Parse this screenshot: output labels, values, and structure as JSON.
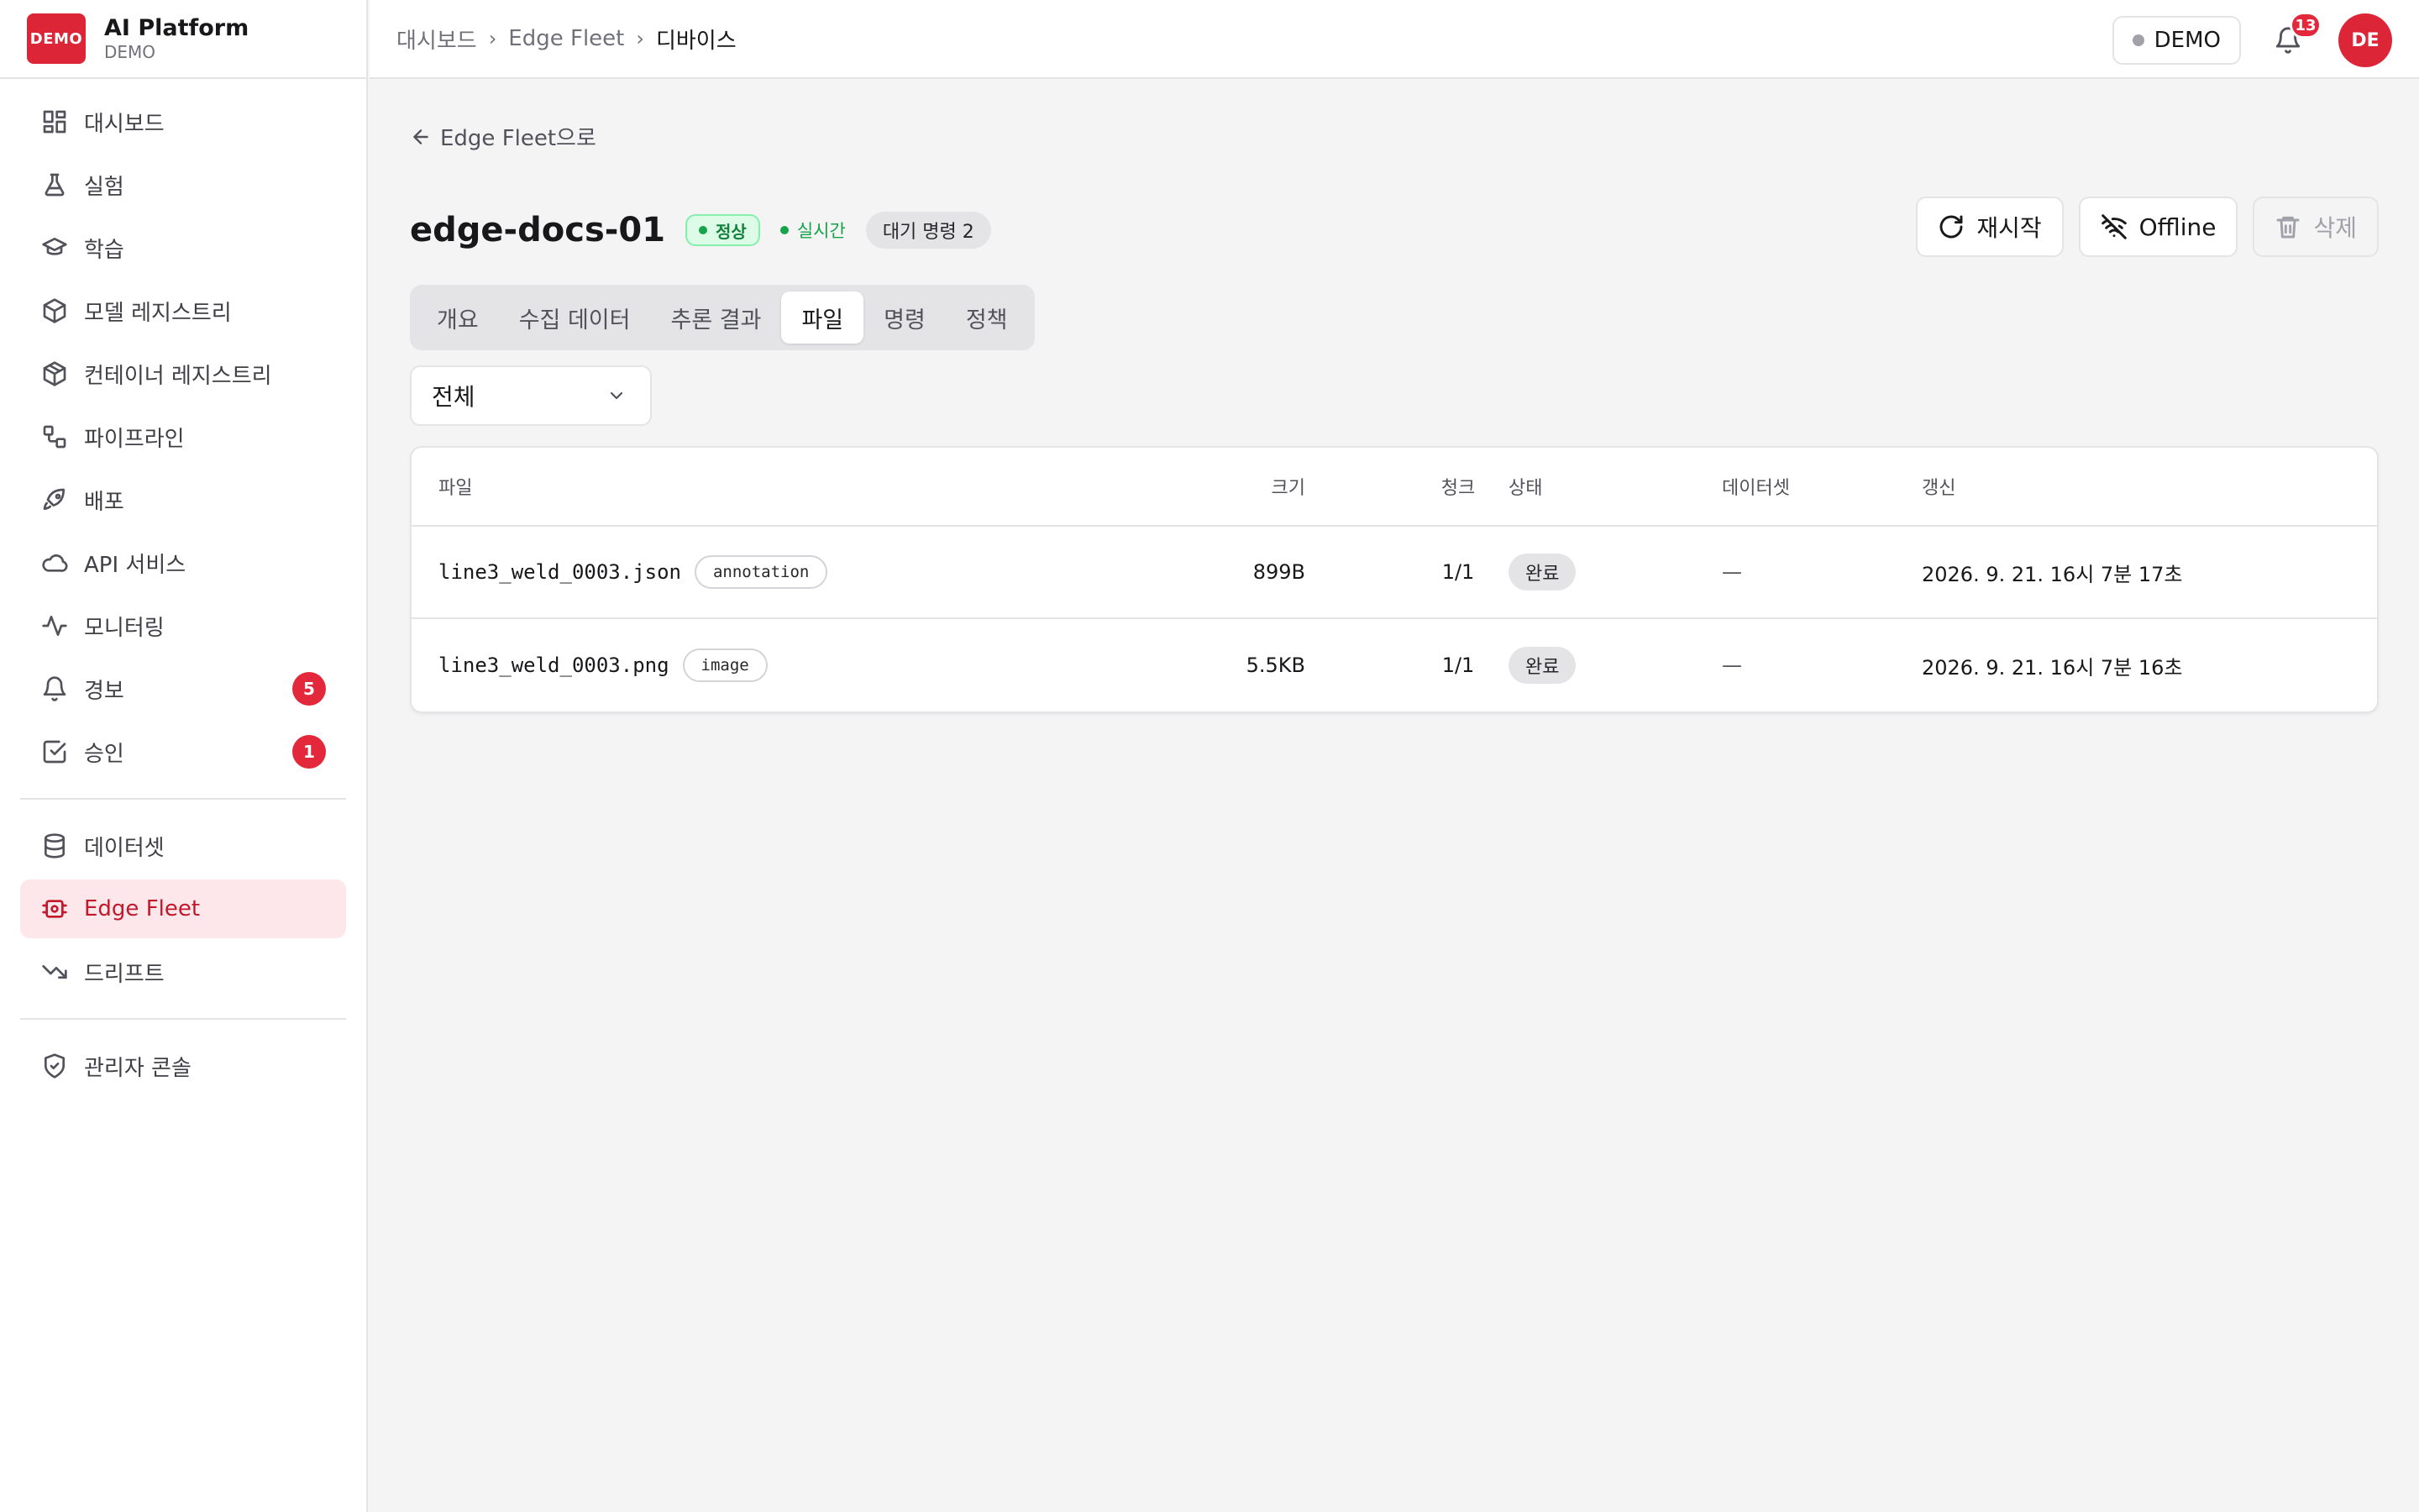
{
  "brand": {
    "logo_text": "DEMO",
    "title": "AI Platform",
    "subtitle": "DEMO"
  },
  "sidebar": {
    "items": [
      {
        "label": "대시보드",
        "icon": "grid-icon"
      },
      {
        "label": "실험",
        "icon": "flask-icon"
      },
      {
        "label": "학습",
        "icon": "graduation-cap-icon"
      },
      {
        "label": "모델 레지스트리",
        "icon": "box-icon"
      },
      {
        "label": "컨테이너 레지스트리",
        "icon": "package-icon"
      },
      {
        "label": "파이프라인",
        "icon": "workflow-icon"
      },
      {
        "label": "배포",
        "icon": "rocket-icon"
      },
      {
        "label": "API 서비스",
        "icon": "cloud-icon"
      },
      {
        "label": "모니터링",
        "icon": "activity-icon"
      },
      {
        "label": "경보",
        "icon": "bell-icon",
        "badge": "5"
      },
      {
        "label": "승인",
        "icon": "check-square-icon",
        "badge": "1"
      }
    ],
    "items2": [
      {
        "label": "데이터셋",
        "icon": "database-icon"
      },
      {
        "label": "Edge Fleet",
        "icon": "edge-device-icon",
        "active": true
      },
      {
        "label": "드리프트",
        "icon": "trending-down-icon"
      }
    ],
    "items3": [
      {
        "label": "관리자 콘솔",
        "icon": "shield-icon"
      }
    ]
  },
  "header": {
    "breadcrumb": [
      "대시보드",
      "Edge Fleet",
      "디바이스"
    ],
    "tenant": "DEMO",
    "notification_count": "13",
    "avatar": "DE"
  },
  "page": {
    "back_label": "Edge Fleet으로",
    "device_name": "edge-docs-01",
    "status": "정상",
    "realtime": "실시간",
    "pending": "대기 명령 2",
    "actions": {
      "restart": "재시작",
      "offline": "Offline",
      "delete": "삭제"
    },
    "tabs": [
      "개요",
      "수집 데이터",
      "추론 결과",
      "파일",
      "명령",
      "정책"
    ],
    "active_tab": "파일",
    "filter": "전체"
  },
  "table": {
    "headers": {
      "file": "파일",
      "size": "크기",
      "chunk": "청크",
      "state": "상태",
      "dataset": "데이터셋",
      "updated": "갱신"
    },
    "rows": [
      {
        "file": "line3_weld_0003.json",
        "tag": "annotation",
        "size": "899B",
        "chunk": "1/1",
        "state": "완료",
        "dataset": "—",
        "updated": "2026. 9. 21. 16시 7분 17초"
      },
      {
        "file": "line3_weld_0003.png",
        "tag": "image",
        "size": "5.5KB",
        "chunk": "1/1",
        "state": "완료",
        "dataset": "—",
        "updated": "2026. 9. 21. 16시 7분 16초"
      }
    ]
  },
  "colors": {
    "accent": "#dc2637",
    "success": "#16a34a",
    "active_nav_bg": "#fde7ea"
  }
}
